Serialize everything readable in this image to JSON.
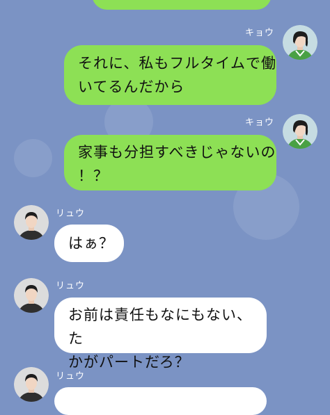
{
  "colors": {
    "background": "#7b93c4",
    "my_bubble": "#8de055",
    "their_bubble": "#ffffff"
  },
  "contacts": {
    "me": {
      "name": "キョウ",
      "avatar_icon": "woman-avatar-icon"
    },
    "other": {
      "name": "リュウ",
      "avatar_icon": "man-avatar-icon"
    }
  },
  "messages": [
    {
      "sender": "キョウ",
      "lines": []
    },
    {
      "sender": "キョウ",
      "lines": [
        "それに、私もフルタイムで働",
        "いてるんだから"
      ]
    },
    {
      "sender": "キョウ",
      "lines": [
        "家事も分担すべきじゃないの",
        "！？"
      ]
    },
    {
      "sender": "リュウ",
      "lines": [
        "はぁ？"
      ]
    },
    {
      "sender": "リュウ",
      "lines": [
        "お前は責任もなにもない、た",
        "かがパートだろ？"
      ]
    },
    {
      "sender": "リュウ",
      "lines": []
    }
  ]
}
